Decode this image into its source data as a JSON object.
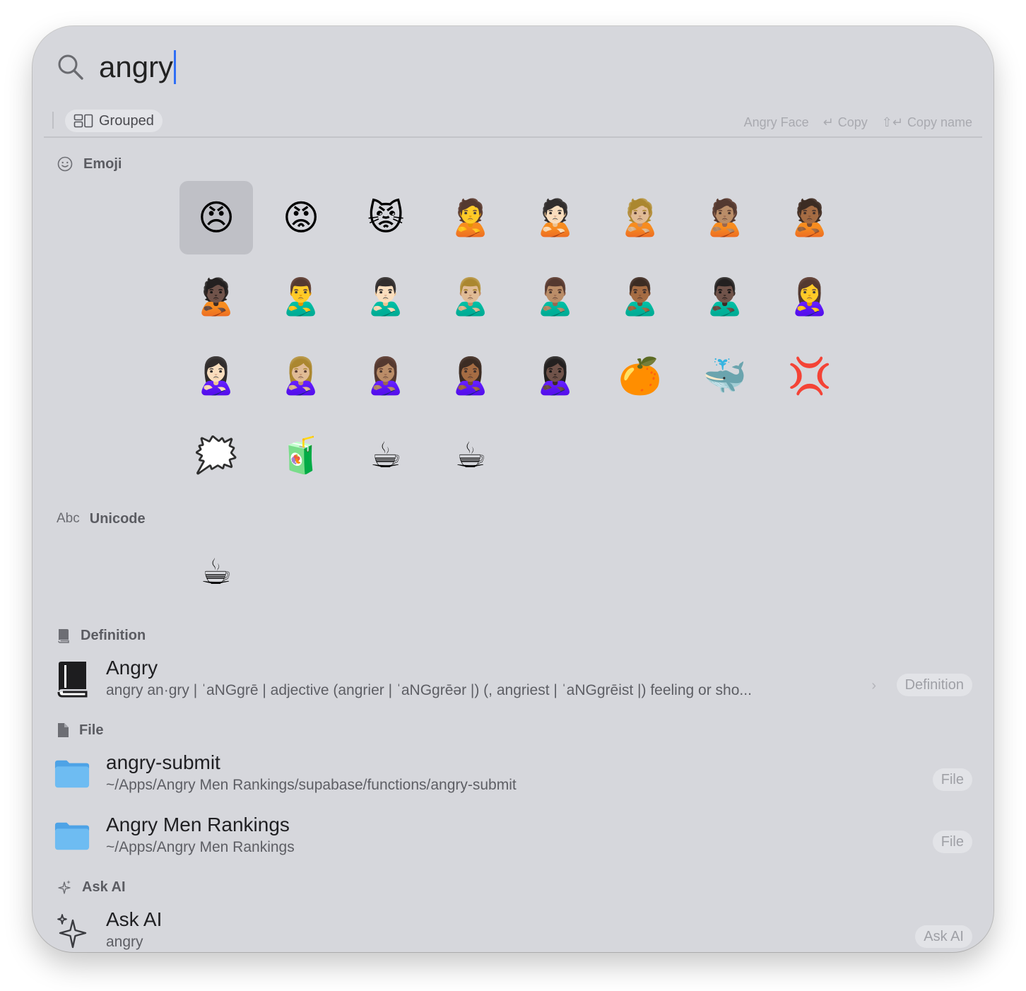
{
  "search": {
    "query": "angry"
  },
  "toolbar": {
    "grouped_label": "Grouped",
    "hint_selected": "Angry Face",
    "hint_copy": "Copy",
    "hint_copy_name": "Copy name",
    "hint_copy_key": "↵",
    "hint_copy_name_key": "⇧↵"
  },
  "sections": {
    "emoji": "Emoji",
    "unicode": "Unicode",
    "unicode_prefix": "Abc",
    "definition": "Definition",
    "file": "File",
    "ask_ai": "Ask AI"
  },
  "emoji": [
    "😠",
    "😡",
    "😾",
    "🙎",
    "🙎🏻",
    "🙎🏼",
    "🙎🏽",
    "🙎🏾",
    "🙎🏿",
    "🙎‍♂️",
    "🙎🏻‍♂️",
    "🙎🏼‍♂️",
    "🙎🏽‍♂️",
    "🙎🏾‍♂️",
    "🙎🏿‍♂️",
    "🙎‍♀️",
    "🙎🏻‍♀️",
    "🙎🏼‍♀️",
    "🙎🏽‍♀️",
    "🙎🏾‍♀️",
    "🙎🏿‍♀️",
    "🍊",
    "🐳",
    "💢",
    "🗯️",
    "🧃",
    "☕",
    "☕"
  ],
  "unicode": [
    "☕"
  ],
  "definition": {
    "title": "Angry",
    "subtitle": "angry an·gry | ˈaNGgrē | adjective (angrier | ˈaNGgrēər |) (, angriest | ˈaNGgrēist |) feeling or sho...",
    "badge": "Definition"
  },
  "files": [
    {
      "title": "angry-submit",
      "subtitle": "~/Apps/Angry Men Rankings/supabase/functions/angry-submit",
      "badge": "File"
    },
    {
      "title": "Angry Men Rankings",
      "subtitle": "~/Apps/Angry Men Rankings",
      "badge": "File"
    }
  ],
  "ask_ai": {
    "title": "Ask AI",
    "subtitle": "angry",
    "badge": "Ask AI"
  },
  "colors": {
    "caret": "#2f6ef5",
    "window": "#d6d7dc",
    "folder": "#5eb0ee"
  }
}
